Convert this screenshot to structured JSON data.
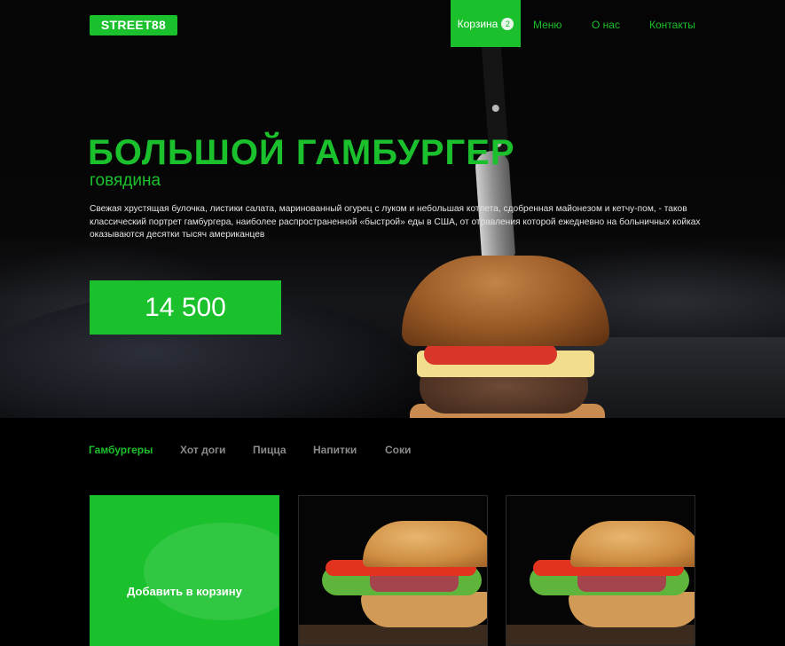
{
  "header": {
    "logo": "STREET88",
    "nav": {
      "cart_label": "Корзина",
      "cart_count": "2",
      "menu": "Меню",
      "about": "О нас",
      "contacts": "Контакты"
    }
  },
  "hero": {
    "title": "БОЛЬШОЙ ГАМБУРГЕР",
    "subtitle": "говядина",
    "description": "Свежая хрустящая булочка, листики салата, маринованный огурец с луком и небольшая котлета, сдобренная майонезом и кетчу-пом, - таков классический портрет гамбургера, наиболее распространенной «быстрой» еды в США, от отравления которой ежедневно на больничных койках оказываются десятки тысяч американцев",
    "price": "14 500"
  },
  "categories": {
    "items": [
      {
        "label": "Гамбургеры",
        "active": true
      },
      {
        "label": "Хот доги",
        "active": false
      },
      {
        "label": "Пицца",
        "active": false
      },
      {
        "label": "Напитки",
        "active": false
      },
      {
        "label": "Соки",
        "active": false
      }
    ]
  },
  "products": {
    "add_to_cart_label": "Добавить в корзину"
  },
  "colors": {
    "accent": "#1bc12d",
    "background": "#000000"
  }
}
